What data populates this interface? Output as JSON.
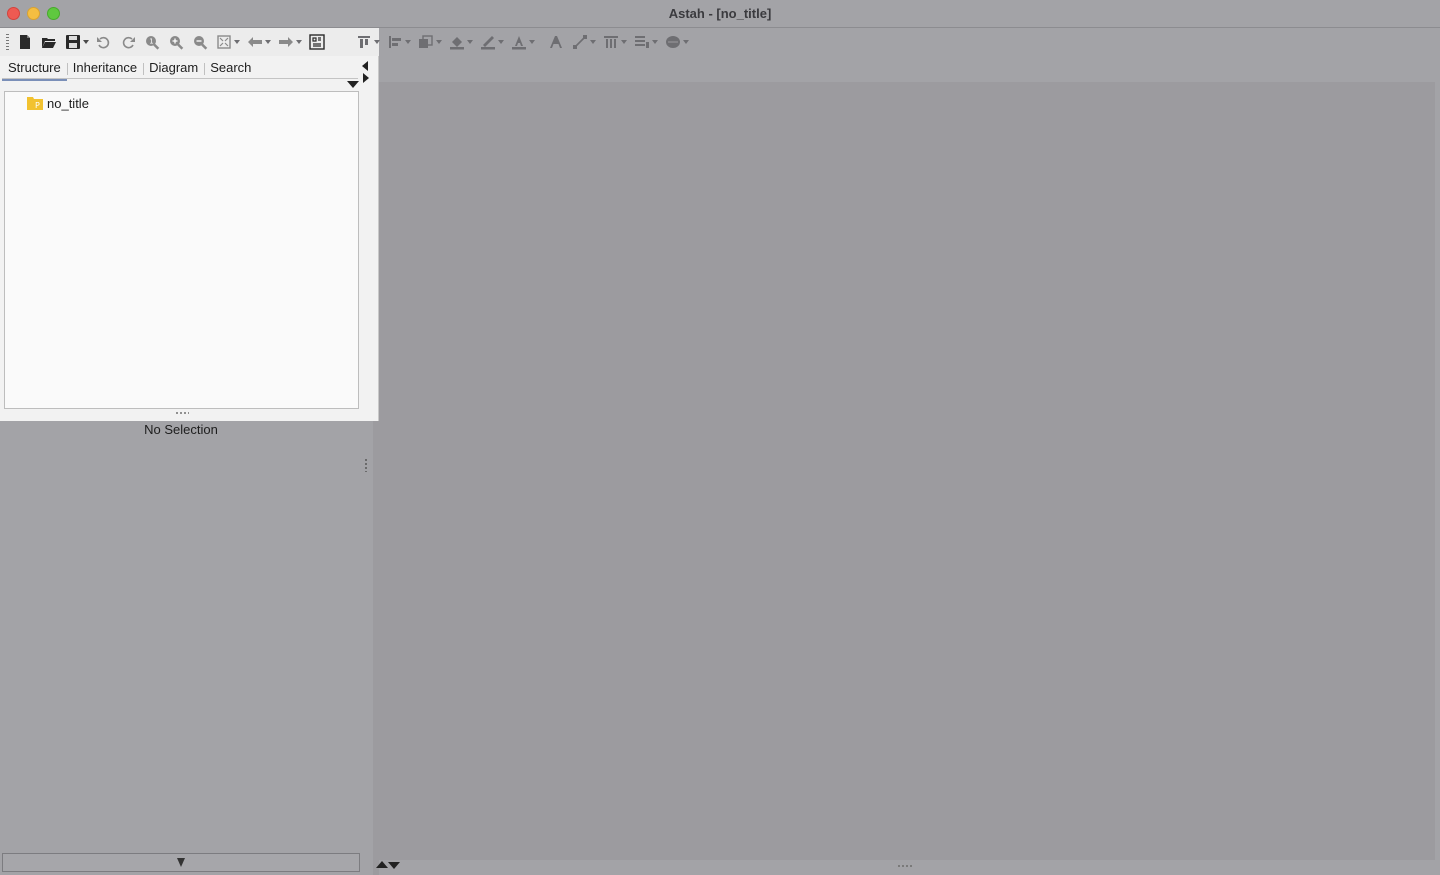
{
  "window": {
    "title": "Astah - [no_title]"
  },
  "colors": {
    "close": "#ee5a52",
    "minimize": "#f5be41",
    "maximize": "#5fc83f",
    "active_tab_underline": "#7a8fb8",
    "package_icon": "#f2c230"
  },
  "toolbar": {
    "items": [
      {
        "icon": "new-file-icon"
      },
      {
        "icon": "open-folder-icon"
      },
      {
        "icon": "save-icon"
      },
      {
        "icon": "undo-icon"
      },
      {
        "icon": "redo-icon"
      },
      {
        "icon": "zoom-fit-icon"
      },
      {
        "icon": "zoom-in-icon"
      },
      {
        "icon": "zoom-out-icon"
      },
      {
        "icon": "fit-window-icon"
      },
      {
        "icon": "back-arrow-icon"
      },
      {
        "icon": "forward-arrow-icon"
      },
      {
        "icon": "show-hide-icon"
      },
      {
        "icon": "align-icon"
      },
      {
        "icon": "distribute-icon"
      },
      {
        "icon": "layer-order-icon"
      },
      {
        "icon": "fill-color-icon"
      },
      {
        "icon": "line-color-icon"
      },
      {
        "icon": "font-color-icon"
      },
      {
        "icon": "font-style-icon"
      },
      {
        "icon": "line-style-icon"
      },
      {
        "icon": "table-icon"
      },
      {
        "icon": "layout-icon"
      },
      {
        "icon": "circle-shape-icon"
      }
    ]
  },
  "project_panel": {
    "tabs": [
      {
        "label": "Structure",
        "active": true
      },
      {
        "label": "Inheritance",
        "active": false
      },
      {
        "label": "Diagram",
        "active": false
      },
      {
        "label": "Search",
        "active": false
      }
    ],
    "tree": [
      {
        "label": "no_title",
        "icon": "package-icon",
        "icon_letter": "P"
      }
    ]
  },
  "property_panel": {
    "empty_text": "No Selection"
  }
}
